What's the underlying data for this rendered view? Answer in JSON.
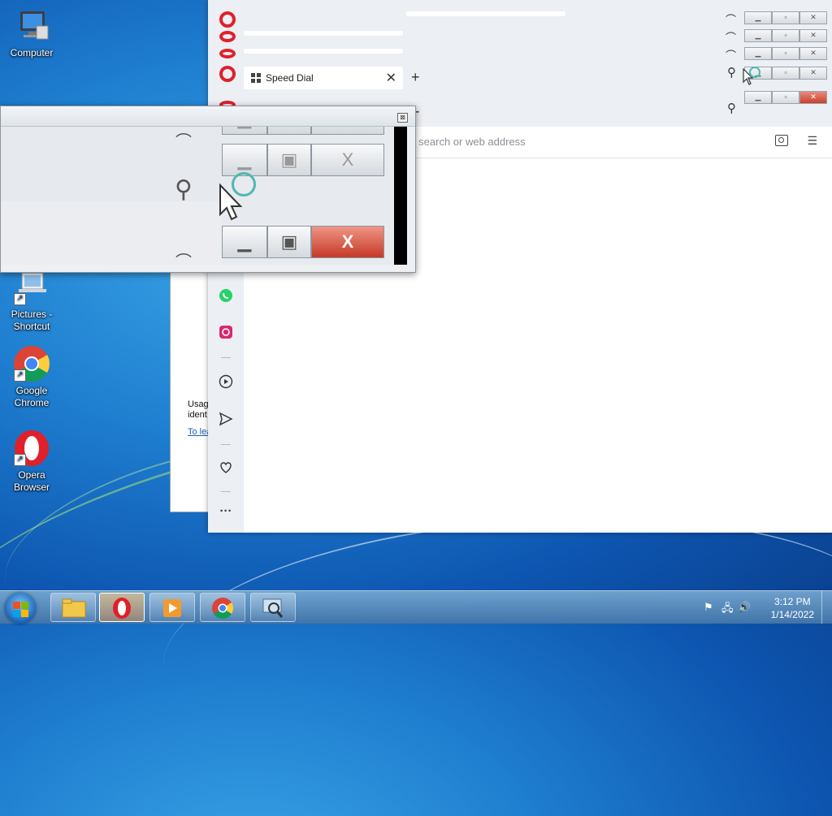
{
  "desktop": {
    "icons": [
      {
        "label": "Computer"
      },
      {
        "label": "Pictures - Shortcut"
      },
      {
        "label": "Google Chrome"
      },
      {
        "label": "Opera Browser"
      }
    ]
  },
  "opera": {
    "active_tab": "Speed Dial",
    "tab_close": "✕",
    "new_tab": "+",
    "address_placeholder": "er search or web address",
    "search_icon": "search-icon",
    "sidebar_icons": [
      "whatsapp-icon",
      "instagram-icon",
      "player-icon",
      "send-icon",
      "heart-icon",
      "more-icon"
    ],
    "more_label": "···"
  },
  "bg_window": {
    "text_line1": "Usag",
    "text_line2": "ident",
    "link": "To lea"
  },
  "magnifier": {
    "close_label": "⊠",
    "min_glyph": "▁",
    "max_glyph": "▣",
    "close_glyph": "X"
  },
  "taskbar": {
    "time": "3:12 PM",
    "date": "1/14/2022"
  },
  "colors": {
    "opera_red": "#e0202a",
    "close_red": "#c8402d",
    "accent_ring": "#4fb8b0"
  }
}
